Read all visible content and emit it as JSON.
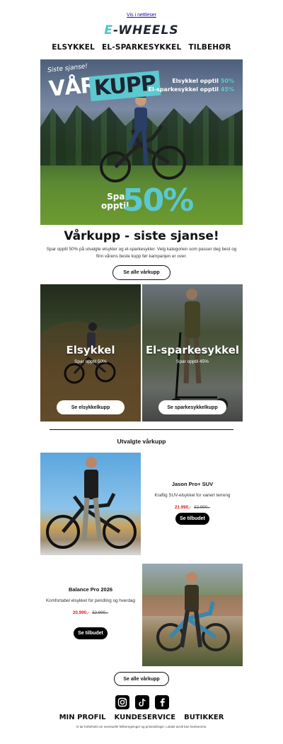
{
  "header": {
    "browser_link": "Vis i nettleser",
    "logo_prefix": "E",
    "logo_rest": "-WHEELS"
  },
  "nav": [
    "ELSYKKEL",
    "EL-SPARKESYKKEL",
    "TILBEHØR"
  ],
  "hero": {
    "sign": "Siste sjanse!",
    "title_a": "VÅR",
    "title_b": "KUPP",
    "promo1_text": "Elsykkel opptil",
    "promo1_pct": "50%",
    "promo2_text": "El-sparkesykkel opptil",
    "promo2_pct": "45%",
    "spar_line1": "Spar",
    "spar_line2": "opptil",
    "big_pct": "50%"
  },
  "intro": {
    "headline": "Vårkupp - siste sjanse!",
    "body": "Spar opptil 50% på utvalgte elsykler og el-sparkesykler. Velg kategorien som passer deg best og finn vårens beste kupp før kampanjen er over.",
    "button": "Se alle vårkupp"
  },
  "categories": [
    {
      "title": "Elsykkel",
      "subtitle": "Spar opptil 50%",
      "button": "Se elsykkelkupp"
    },
    {
      "title": "El-sparkesykkel",
      "subtitle": "Spar opptil 45%",
      "button": "Se sparkesykkelkupp"
    }
  ],
  "featured_title": "Utvalgte vårkupp",
  "products": [
    {
      "name": "Jason Pro+ SUV",
      "desc": "Kraftig SUV-elsykkel for variert terreng",
      "price_new": "21.990,-",
      "price_old": "32.990,-",
      "button": "Se tilbudet"
    },
    {
      "name": "Balance Pro 2026",
      "desc": "Komfortabel elsykkel for pendling og hverdag",
      "price_new": "20.990,-",
      "price_old": "32.990,-",
      "button": "Se tilbudet"
    }
  ],
  "bottom_button": "Se alle vårkupp",
  "social": [
    "instagram-icon",
    "tiktok-icon",
    "facebook-icon"
  ],
  "footer_nav": [
    "MIN PROFIL",
    "KUNDESERVICE",
    "BUTIKKER"
  ],
  "disclaimer": "Vi tar forbehold om eventuelle feilberegninger og prisendringer. Lokale avvik kan forekomme."
}
